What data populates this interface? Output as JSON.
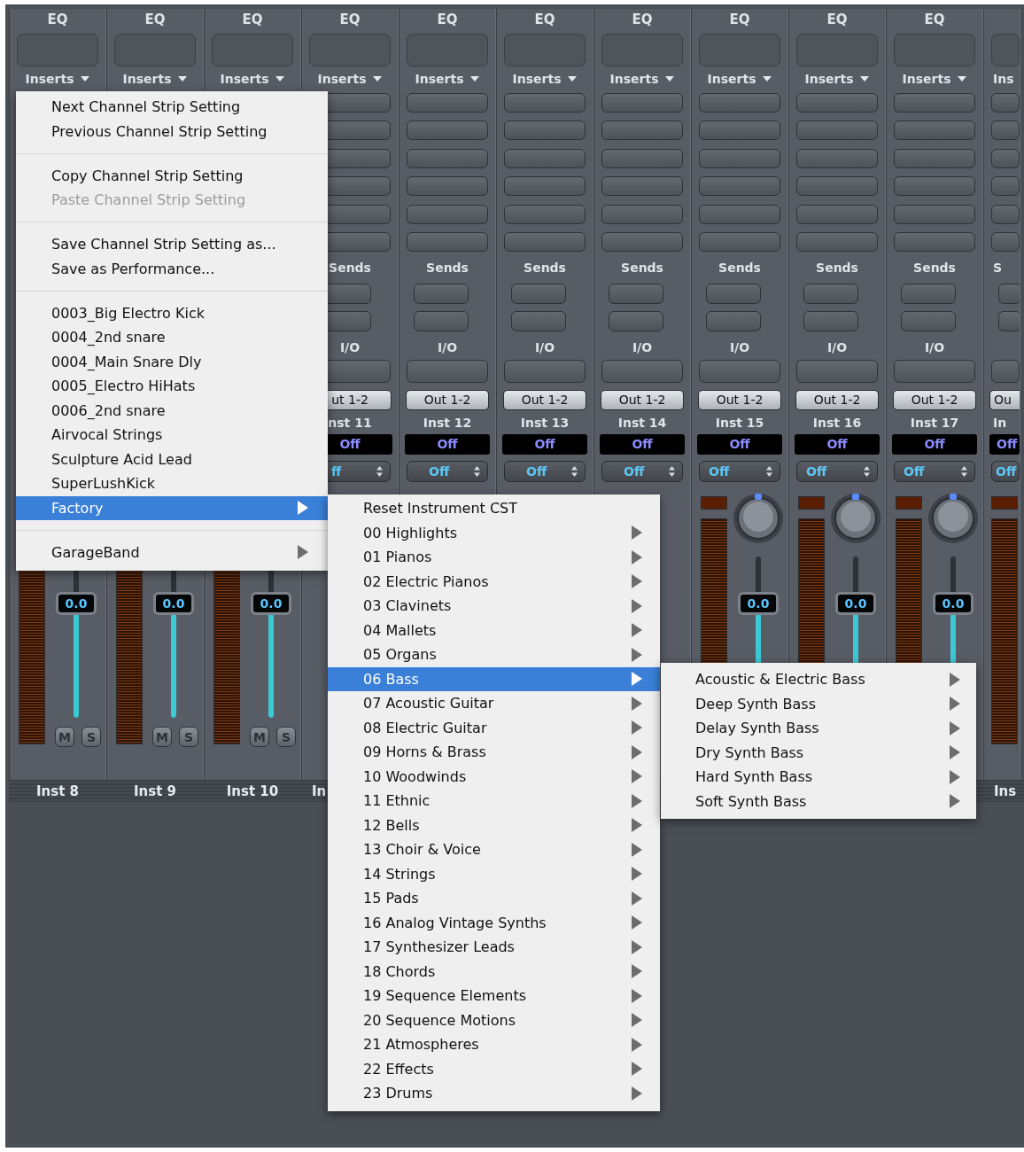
{
  "strips": [
    {
      "kind": "lower",
      "eq": "EQ",
      "inserts": "Inserts",
      "level": 0.71,
      "fader_value": "0.0",
      "mute": "M",
      "solo": "S",
      "name": "Inst 8"
    },
    {
      "kind": "lower",
      "eq": "EQ",
      "inserts": "Inserts",
      "level": 0.71,
      "fader_value": "0.0",
      "mute": "M",
      "solo": "S",
      "name": "Inst 9"
    },
    {
      "kind": "lower",
      "eq": "EQ",
      "inserts": "Inserts",
      "level": 0.71,
      "fader_value": "0.0",
      "mute": "M",
      "solo": "S",
      "name": "Inst 10"
    },
    {
      "kind": "upper",
      "eq": "EQ",
      "inserts": "Inserts",
      "sends": "Sends",
      "io": "I/O",
      "output": "ut 1-2",
      "channel_label": "nst 11",
      "group": "Off",
      "automation": "ff",
      "name": "In"
    },
    {
      "kind": "upper",
      "eq": "EQ",
      "inserts": "Inserts",
      "sends": "Sends",
      "io": "I/O",
      "output": "Out 1-2",
      "channel_label": "Inst 12",
      "group": "Off",
      "automation": "Off"
    },
    {
      "kind": "upper",
      "eq": "EQ",
      "inserts": "Inserts",
      "sends": "Sends",
      "io": "I/O",
      "output": "Out 1-2",
      "channel_label": "Inst 13",
      "group": "Off",
      "automation": "Off"
    },
    {
      "kind": "upper",
      "eq": "EQ",
      "inserts": "Inserts",
      "sends": "Sends",
      "io": "I/O",
      "output": "Out 1-2",
      "channel_label": "Inst 14",
      "group": "Off",
      "automation": "Off"
    },
    {
      "kind": "middle",
      "eq": "EQ",
      "inserts": "Inserts",
      "sends": "Sends",
      "io": "I/O",
      "output": "Out 1-2",
      "channel_label": "Inst 15",
      "group": "Off",
      "automation": "Off",
      "level": 0.71,
      "fader_value": "0.0"
    },
    {
      "kind": "middle",
      "eq": "EQ",
      "inserts": "Inserts",
      "sends": "Sends",
      "io": "I/O",
      "output": "Out 1-2",
      "channel_label": "Inst 16",
      "group": "Off",
      "automation": "Off",
      "level": 0.71,
      "fader_value": "0.0"
    },
    {
      "kind": "middle",
      "eq": "EQ",
      "inserts": "Inserts",
      "sends": "Sends",
      "io": "I/O",
      "output": "Out 1-2",
      "channel_label": "Inst 17",
      "group": "Off",
      "automation": "Off",
      "level": 0.71,
      "fader_value": "0.0"
    },
    {
      "kind": "edge",
      "inserts": "Ins",
      "sends": "S",
      "output": "Ou",
      "channel_label": "In",
      "group": "Off",
      "automation": "Off",
      "name": "Ins"
    }
  ],
  "channel_menu": {
    "items": [
      {
        "kind": "item",
        "label": "Next Channel Strip Setting",
        "selected": false,
        "disabled": false
      },
      {
        "kind": "item",
        "label": "Previous Channel Strip Setting",
        "selected": false,
        "disabled": false
      },
      {
        "kind": "separator"
      },
      {
        "kind": "item",
        "label": "Copy Channel Strip Setting",
        "selected": false,
        "disabled": false
      },
      {
        "kind": "item",
        "label": "Paste Channel Strip Setting",
        "selected": false,
        "disabled": true
      },
      {
        "kind": "separator"
      },
      {
        "kind": "item",
        "label": "Save Channel Strip Setting as...",
        "selected": false,
        "disabled": false
      },
      {
        "kind": "item",
        "label": "Save as Performance...",
        "selected": false,
        "disabled": false
      },
      {
        "kind": "separator"
      },
      {
        "kind": "item",
        "label": "0003_Big Electro Kick",
        "selected": false,
        "disabled": false
      },
      {
        "kind": "item",
        "label": "0004_2nd snare",
        "selected": false,
        "disabled": false
      },
      {
        "kind": "item",
        "label": "0004_Main Snare Dly",
        "selected": false,
        "disabled": false
      },
      {
        "kind": "item",
        "label": "0005_Electro HiHats",
        "selected": false,
        "disabled": false
      },
      {
        "kind": "item",
        "label": "0006_2nd snare",
        "selected": false,
        "disabled": false
      },
      {
        "kind": "item",
        "label": "Airvocal Strings",
        "selected": false,
        "disabled": false
      },
      {
        "kind": "item",
        "label": "Sculpture Acid Lead",
        "selected": false,
        "disabled": false
      },
      {
        "kind": "item",
        "label": "SuperLushKick",
        "selected": false,
        "disabled": false
      },
      {
        "kind": "submenu",
        "label": "Factory",
        "selected": true,
        "disabled": false
      },
      {
        "kind": "separator"
      },
      {
        "kind": "submenu",
        "label": "GarageBand",
        "selected": false,
        "disabled": false
      }
    ]
  },
  "factory_menu": {
    "items": [
      {
        "kind": "item",
        "label": "Reset Instrument CST",
        "selected": false,
        "disabled": false
      },
      {
        "kind": "submenu",
        "label": "00 Highlights",
        "selected": false,
        "disabled": false
      },
      {
        "kind": "submenu",
        "label": "01 Pianos",
        "selected": false,
        "disabled": false
      },
      {
        "kind": "submenu",
        "label": "02 Electric Pianos",
        "selected": false,
        "disabled": false
      },
      {
        "kind": "submenu",
        "label": "03 Clavinets",
        "selected": false,
        "disabled": false
      },
      {
        "kind": "submenu",
        "label": "04 Mallets",
        "selected": false,
        "disabled": false
      },
      {
        "kind": "submenu",
        "label": "05 Organs",
        "selected": false,
        "disabled": false
      },
      {
        "kind": "submenu",
        "label": "06 Bass",
        "selected": true,
        "disabled": false
      },
      {
        "kind": "submenu",
        "label": "07 Acoustic Guitar",
        "selected": false,
        "disabled": false
      },
      {
        "kind": "submenu",
        "label": "08 Electric Guitar",
        "selected": false,
        "disabled": false
      },
      {
        "kind": "submenu",
        "label": "09 Horns & Brass",
        "selected": false,
        "disabled": false
      },
      {
        "kind": "submenu",
        "label": "10 Woodwinds",
        "selected": false,
        "disabled": false
      },
      {
        "kind": "submenu",
        "label": "11 Ethnic",
        "selected": false,
        "disabled": false
      },
      {
        "kind": "submenu",
        "label": "12 Bells",
        "selected": false,
        "disabled": false
      },
      {
        "kind": "submenu",
        "label": "13 Choir & Voice",
        "selected": false,
        "disabled": false
      },
      {
        "kind": "submenu",
        "label": "14 Strings",
        "selected": false,
        "disabled": false
      },
      {
        "kind": "submenu",
        "label": "15 Pads",
        "selected": false,
        "disabled": false
      },
      {
        "kind": "submenu",
        "label": "16 Analog Vintage Synths",
        "selected": false,
        "disabled": false
      },
      {
        "kind": "submenu",
        "label": "17 Synthesizer Leads",
        "selected": false,
        "disabled": false
      },
      {
        "kind": "submenu",
        "label": "18 Chords",
        "selected": false,
        "disabled": false
      },
      {
        "kind": "submenu",
        "label": "19 Sequence Elements",
        "selected": false,
        "disabled": false
      },
      {
        "kind": "submenu",
        "label": "20 Sequence Motions",
        "selected": false,
        "disabled": false
      },
      {
        "kind": "submenu",
        "label": "21 Atmospheres",
        "selected": false,
        "disabled": false
      },
      {
        "kind": "submenu",
        "label": "22 Effects",
        "selected": false,
        "disabled": false
      },
      {
        "kind": "submenu",
        "label": "23 Drums",
        "selected": false,
        "disabled": false
      }
    ]
  },
  "bass_menu": {
    "items": [
      {
        "kind": "submenu",
        "label": "Acoustic & Electric Bass",
        "selected": false,
        "disabled": false
      },
      {
        "kind": "submenu",
        "label": "Deep Synth Bass",
        "selected": false,
        "disabled": false
      },
      {
        "kind": "submenu",
        "label": "Delay Synth Bass",
        "selected": false,
        "disabled": false
      },
      {
        "kind": "submenu",
        "label": "Dry Synth Bass",
        "selected": false,
        "disabled": false
      },
      {
        "kind": "submenu",
        "label": "Hard Synth Bass",
        "selected": false,
        "disabled": false
      },
      {
        "kind": "submenu",
        "label": "Soft Synth Bass",
        "selected": false,
        "disabled": false
      }
    ]
  }
}
